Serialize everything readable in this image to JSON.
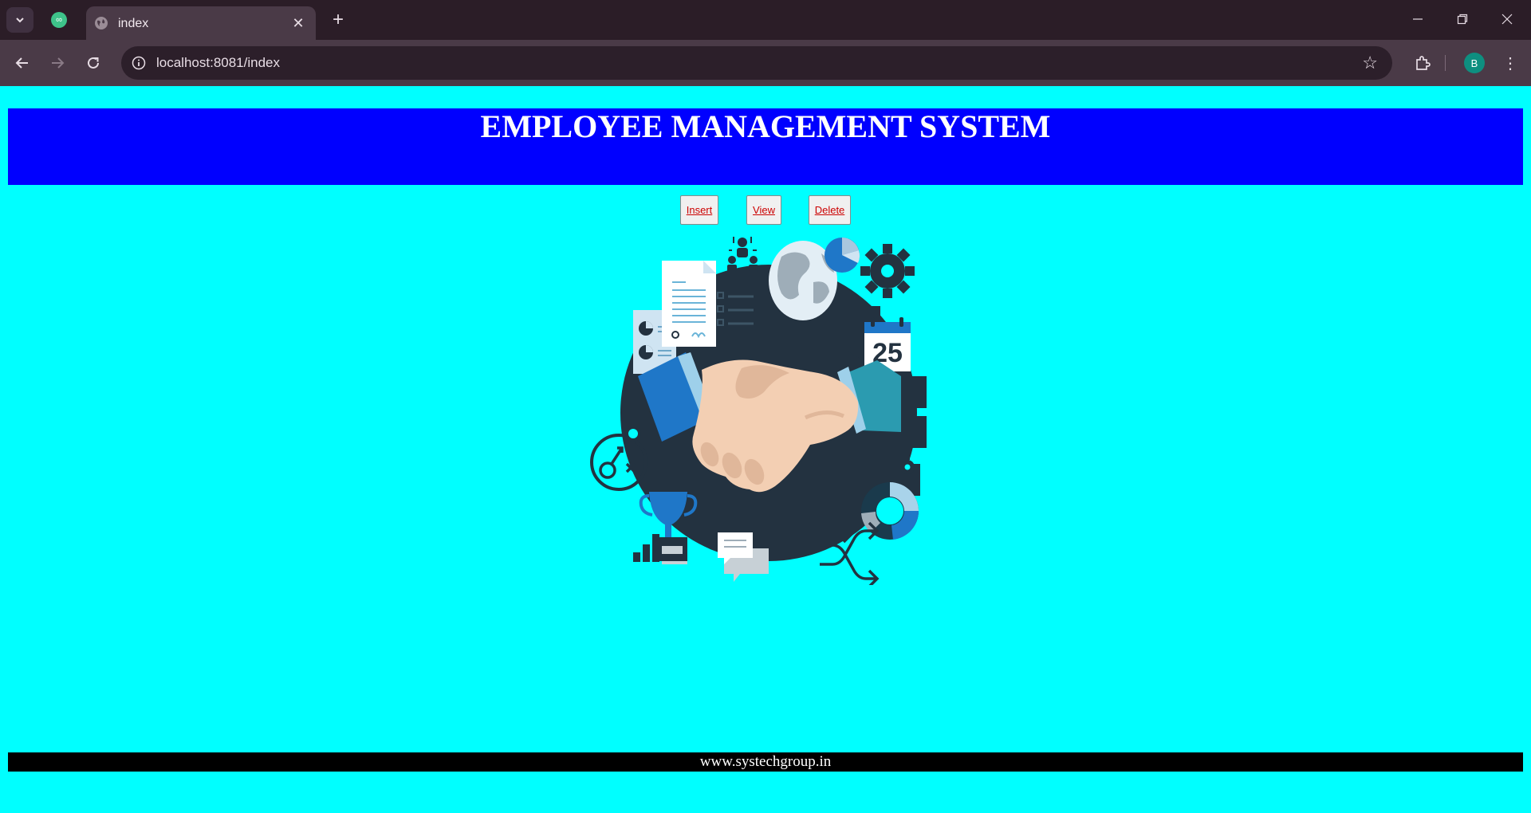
{
  "browser": {
    "tab_title": "index",
    "url": "localhost:8081/index",
    "profile_initial": "B"
  },
  "page": {
    "header_title": "EMPLOYEE MANAGEMENT SYSTEM",
    "nav_links": [
      {
        "label": "Insert"
      },
      {
        "label": "View"
      },
      {
        "label": "Delete"
      }
    ],
    "illustration": {
      "calendar_number": "25"
    },
    "footer_text": "www.systechgroup.in"
  },
  "colors": {
    "page_background": "#00ffff",
    "header_background": "#0000ff",
    "footer_background": "#000000",
    "link_color": "#cc0000"
  }
}
